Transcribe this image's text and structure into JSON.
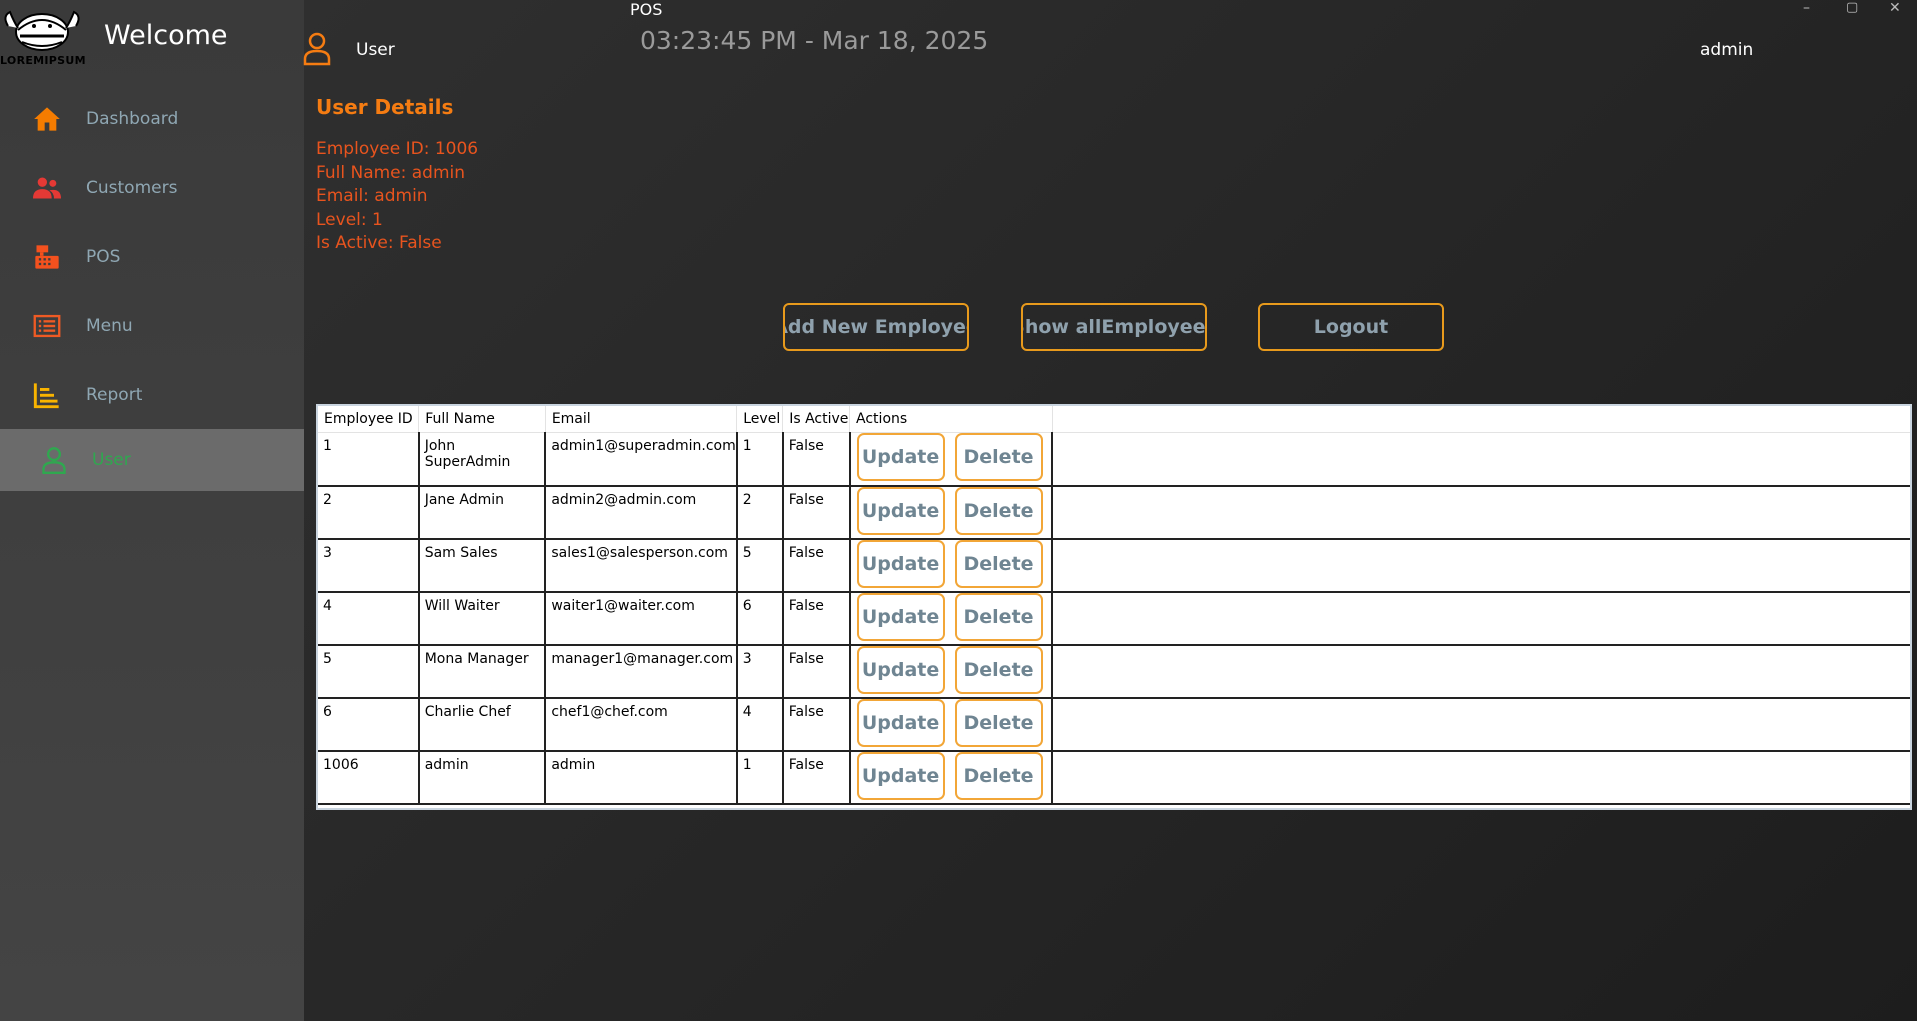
{
  "sidebar": {
    "logo_text": "LOREMIPSUM",
    "welcome": "Welcome",
    "items": [
      {
        "label": "Dashboard",
        "icon": "home-icon",
        "color": "#f57c00"
      },
      {
        "label": "Customers",
        "icon": "users-icon",
        "color": "#e53935"
      },
      {
        "label": "POS",
        "icon": "cash-register-icon",
        "color": "#f4511e"
      },
      {
        "label": "Menu",
        "icon": "list-icon",
        "color": "#ef5a24"
      },
      {
        "label": "Report",
        "icon": "chart-icon",
        "color": "#f9b400"
      },
      {
        "label": "User",
        "icon": "user-icon",
        "color": "#2fa84f",
        "active": true
      }
    ]
  },
  "window": {
    "title": "POS",
    "minimize": "–",
    "maximize": "▢",
    "close": "✕"
  },
  "header": {
    "section_label": "User",
    "clock": "03:23:45 PM - Mar 18, 2025",
    "current_user": "admin"
  },
  "details": {
    "title": "User Details",
    "employee_id": "Employee ID: 1006",
    "full_name": "Full Name: admin",
    "email": "Email: admin",
    "level": "Level: 1",
    "is_active": "Is Active: False"
  },
  "buttons": {
    "add": "Add New Employee",
    "show_all": "Show allEmployees",
    "logout": "Logout"
  },
  "table": {
    "headers": {
      "id": "Employee ID",
      "name": "Full Name",
      "email": "Email",
      "level": "Level",
      "active": "Is Active",
      "actions": "Actions"
    },
    "update_label": "Update",
    "delete_label": "Delete",
    "rows": [
      {
        "id": "1",
        "name": "John SuperAdmin",
        "email": "admin1@superadmin.com",
        "level": "1",
        "active": "False"
      },
      {
        "id": "2",
        "name": "Jane Admin",
        "email": "admin2@admin.com",
        "level": "2",
        "active": "False"
      },
      {
        "id": "3",
        "name": "Sam Sales",
        "email": "sales1@salesperson.com",
        "level": "5",
        "active": "False"
      },
      {
        "id": "4",
        "name": "Will Waiter",
        "email": "waiter1@waiter.com",
        "level": "6",
        "active": "False"
      },
      {
        "id": "5",
        "name": "Mona Manager",
        "email": "manager1@manager.com",
        "level": "3",
        "active": "False"
      },
      {
        "id": "6",
        "name": "Charlie Chef",
        "email": "chef1@chef.com",
        "level": "4",
        "active": "False"
      },
      {
        "id": "1006",
        "name": "admin",
        "email": "admin",
        "level": "1",
        "active": "False"
      }
    ]
  },
  "colors": {
    "accent_orange": "#f57c12",
    "details_text": "#e8541e",
    "button_border": "#e89a1c",
    "active_nav": "#2fa84f"
  }
}
